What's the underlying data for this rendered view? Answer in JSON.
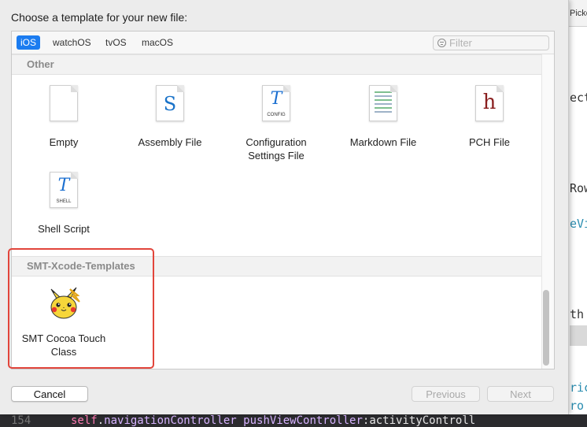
{
  "dialog": {
    "title": "Choose a template for your new file:",
    "platform_tabs": [
      "iOS",
      "watchOS",
      "tvOS",
      "macOS"
    ],
    "selected_tab": "iOS",
    "filter": {
      "placeholder": "Filter",
      "value": ""
    },
    "sections": [
      {
        "header": "Other",
        "templates": [
          {
            "label": "Empty",
            "icon": "blank-document-icon"
          },
          {
            "label": "Assembly File",
            "icon": "assembly-s-document-icon"
          },
          {
            "label": "Configuration Settings File",
            "icon": "config-document-icon",
            "icon_caption": "CONFIG"
          },
          {
            "label": "Markdown File",
            "icon": "markdown-document-icon"
          },
          {
            "label": "PCH File",
            "icon": "header-h-document-icon"
          },
          {
            "label": "Shell Script",
            "icon": "shell-document-icon",
            "icon_caption": "SHELL"
          }
        ]
      },
      {
        "header": "SMT-Xcode-Templates",
        "templates": [
          {
            "label": "SMT Cocoa Touch Class",
            "icon": "pikachu-icon"
          }
        ]
      }
    ],
    "buttons": {
      "cancel": "Cancel",
      "previous": "Previous",
      "next": "Next"
    },
    "highlight_color": "#e2453b",
    "accent_color": "#1b7cf0"
  },
  "background_editor": {
    "tab_label": "Picke",
    "code_fragments": [
      "ect",
      "Row",
      "eVi",
      "th",
      "ric",
      "ro"
    ],
    "bottom_line_number": "154",
    "bottom_line": {
      "self": "self",
      "dot": ".",
      "nav": "navigationController pushViewController",
      "colon": ":",
      "arg": "activityControll"
    }
  }
}
